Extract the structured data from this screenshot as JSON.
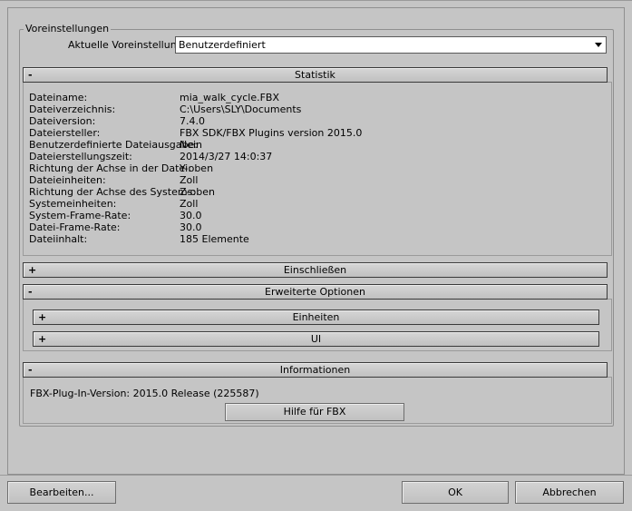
{
  "presets": {
    "group_label": "Voreinstellungen",
    "current_label": "Aktuelle Voreinstellung:",
    "current_value": "Benutzerdefiniert"
  },
  "statistics": {
    "sign": "-",
    "title": "Statistik",
    "rows": [
      {
        "label": "Dateiname:",
        "value": "mia_walk_cycle.FBX"
      },
      {
        "label": "Dateiverzeichnis:",
        "value": "C:\\Users\\SLY\\Documents"
      },
      {
        "label": "Dateiversion:",
        "value": "7.4.0"
      },
      {
        "label": "Dateiersteller:",
        "value": "FBX SDK/FBX Plugins version 2015.0"
      },
      {
        "label": "Benutzerdefinierte Dateiausgabe:",
        "value": "Nein"
      },
      {
        "label": "Dateierstellungszeit:",
        "value": "2014/3/27  14:0:37"
      },
      {
        "label": "Richtung der Achse in der Datei:",
        "value": "Y-oben"
      },
      {
        "label": "Dateieinheiten:",
        "value": "Zoll"
      },
      {
        "label": "Richtung der Achse des Systems:",
        "value": "Z-oben"
      },
      {
        "label": "Systemeinheiten:",
        "value": "Zoll"
      },
      {
        "label": "System-Frame-Rate:",
        "value": "30.0"
      },
      {
        "label": "Datei-Frame-Rate:",
        "value": "30.0"
      },
      {
        "label": "Dateiinhalt:",
        "value": "185 Elemente"
      }
    ]
  },
  "include": {
    "sign": "+",
    "title": "Einschließen"
  },
  "advanced": {
    "sign": "-",
    "title": "Erweiterte Optionen",
    "units": {
      "sign": "+",
      "title": "Einheiten"
    },
    "ui": {
      "sign": "+",
      "title": "UI"
    }
  },
  "information": {
    "sign": "-",
    "title": "Informationen",
    "version_text": "FBX-Plug-In-Version: 2015.0 Release (225587)",
    "help_button": "Hilfe für FBX"
  },
  "footer": {
    "edit_button": "Bearbeiten...",
    "ok_button": "OK",
    "cancel_button": "Abbrechen"
  }
}
